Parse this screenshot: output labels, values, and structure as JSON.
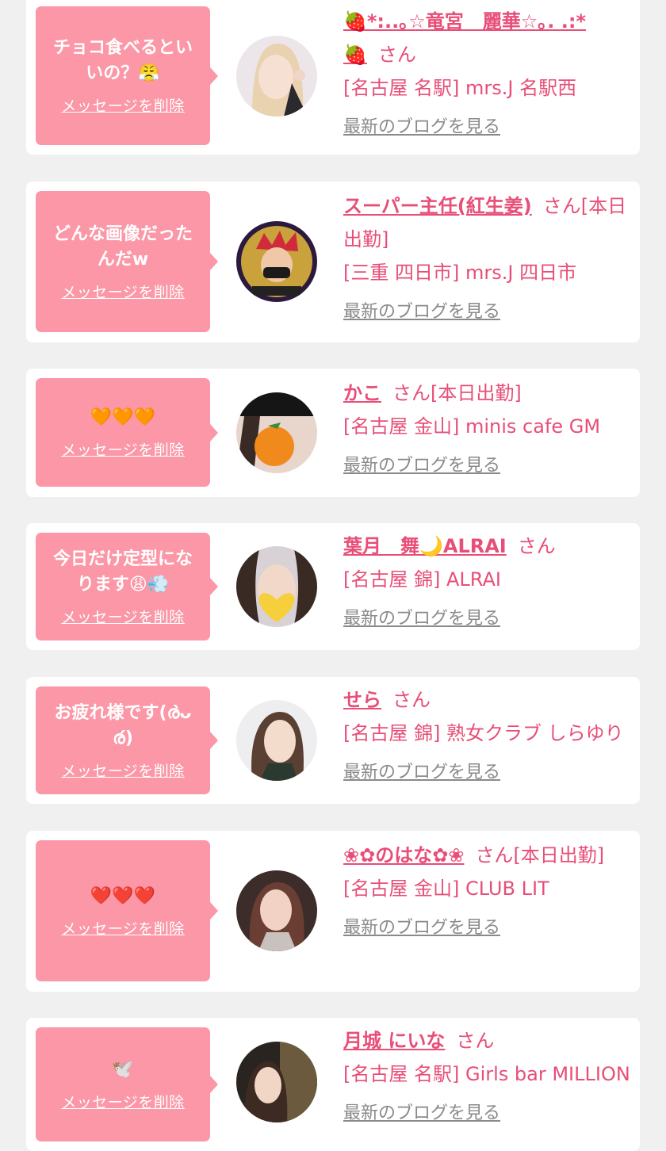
{
  "delete_label": "メッセージを削除",
  "blog_label": "最新のブログを見る",
  "san": "さん",
  "status": "[本日出勤]",
  "colors": {
    "accent": "#e84e77",
    "bubble": "#fb97a6",
    "link_gray": "#8a8a8a"
  },
  "messages": [
    {
      "bubble": "チョコ食べるといいの？😤",
      "name": "🍓*:..｡☆竜宮　麗華☆｡. .:*\n🍓",
      "status": "",
      "shop": "[名古屋 名駅] mrs.J 名駅西",
      "avatar_icon": "blonde-woman-photo"
    },
    {
      "bubble": "どんな画像だったんだw",
      "name": "スーパー主任(紅生姜)",
      "status": "[本日出勤]",
      "shop": "[三重 四日市] mrs.J 四日市",
      "avatar_icon": "anime-character-logo"
    },
    {
      "bubble": "🧡🧡🧡",
      "name": "かこ",
      "status": "[本日出勤]",
      "shop": "[名古屋 金山] minis cafe GM",
      "avatar_icon": "orange-covered-face-photo"
    },
    {
      "bubble": "今日だけ定型になります😩💨",
      "name": "葉月　舞🌙ALRAI",
      "status": "",
      "shop": "[名古屋 錦] ALRAI",
      "avatar_icon": "heart-covered-face-photo"
    },
    {
      "bubble": "お疲れ様です(ര̀ᴗര́)",
      "name": "せら",
      "status": "",
      "shop": "[名古屋 錦] 熟女クラブ しらゆり",
      "avatar_icon": "woman-photo"
    },
    {
      "bubble": "❤️❤️❤️",
      "name": "❀✿のはな✿❀",
      "status": "[本日出勤]",
      "shop": "[名古屋 金山] CLUB LIT",
      "avatar_icon": "woman-photo"
    },
    {
      "bubble": "🕊️",
      "name": "月城 にいな",
      "status": "",
      "shop": "[名古屋 名駅] Girls bar MILLION",
      "avatar_icon": "woman-photo"
    }
  ]
}
